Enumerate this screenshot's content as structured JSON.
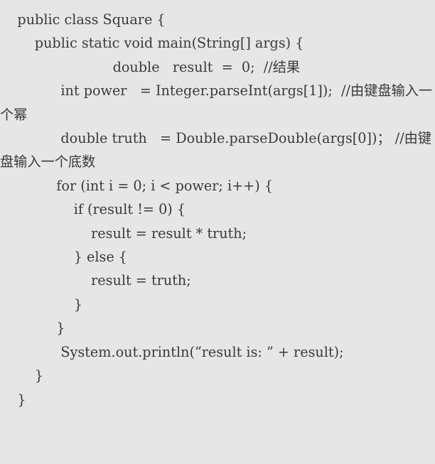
{
  "window": {
    "kind": "code-snippet-viewer",
    "background_color": "#e6e6e6",
    "text_color": "#3a3a3a"
  },
  "code": {
    "language": "java",
    "class_name": "Square",
    "lines": [
      "    public class Square {",
      "        public static void main(String[] args) {",
      "                          double   result  =  0;  //结果",
      "              int power   = Integer.parseInt(args[1]);  //由键盘输入一个幂",
      "              double truth   = Double.parseDouble(args[0])； //由键盘输入一个底数",
      "             for (int i = 0; i < power; i++) {",
      "                 if (result != 0) {",
      "                     result = result * truth;",
      "                 } else {",
      "                     result = truth;",
      "                 }",
      "             }",
      "              System.out.println(“result is: ” + result);",
      "        }",
      "    }"
    ]
  }
}
